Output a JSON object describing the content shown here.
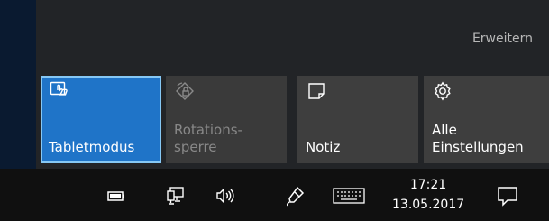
{
  "panel": {
    "expand_label": "Erweitern"
  },
  "tiles": [
    {
      "id": "tablet",
      "label": "Tabletmodus",
      "icon": "tablet-mode-icon",
      "active": true
    },
    {
      "id": "rotation",
      "label": "Rotations-\nsperre",
      "icon": "rotation-lock-icon",
      "disabled": true
    },
    {
      "id": "notiz",
      "label": "Notiz",
      "icon": "note-icon"
    },
    {
      "id": "settings",
      "label": "Alle\nEinstellungen",
      "icon": "gear-icon"
    }
  ],
  "taskbar": {
    "tray_icons": [
      "battery-icon",
      "network-icon",
      "volume-icon",
      "pen-icon",
      "keyboard-icon"
    ],
    "time": "17:21",
    "date": "13.05.2017",
    "action_center_icon": "action-center-icon"
  },
  "colors": {
    "accent": "#1f74c8",
    "accent_border": "#86c8f5",
    "tile": "#3e3e3e",
    "panel_bg": "#222427"
  }
}
